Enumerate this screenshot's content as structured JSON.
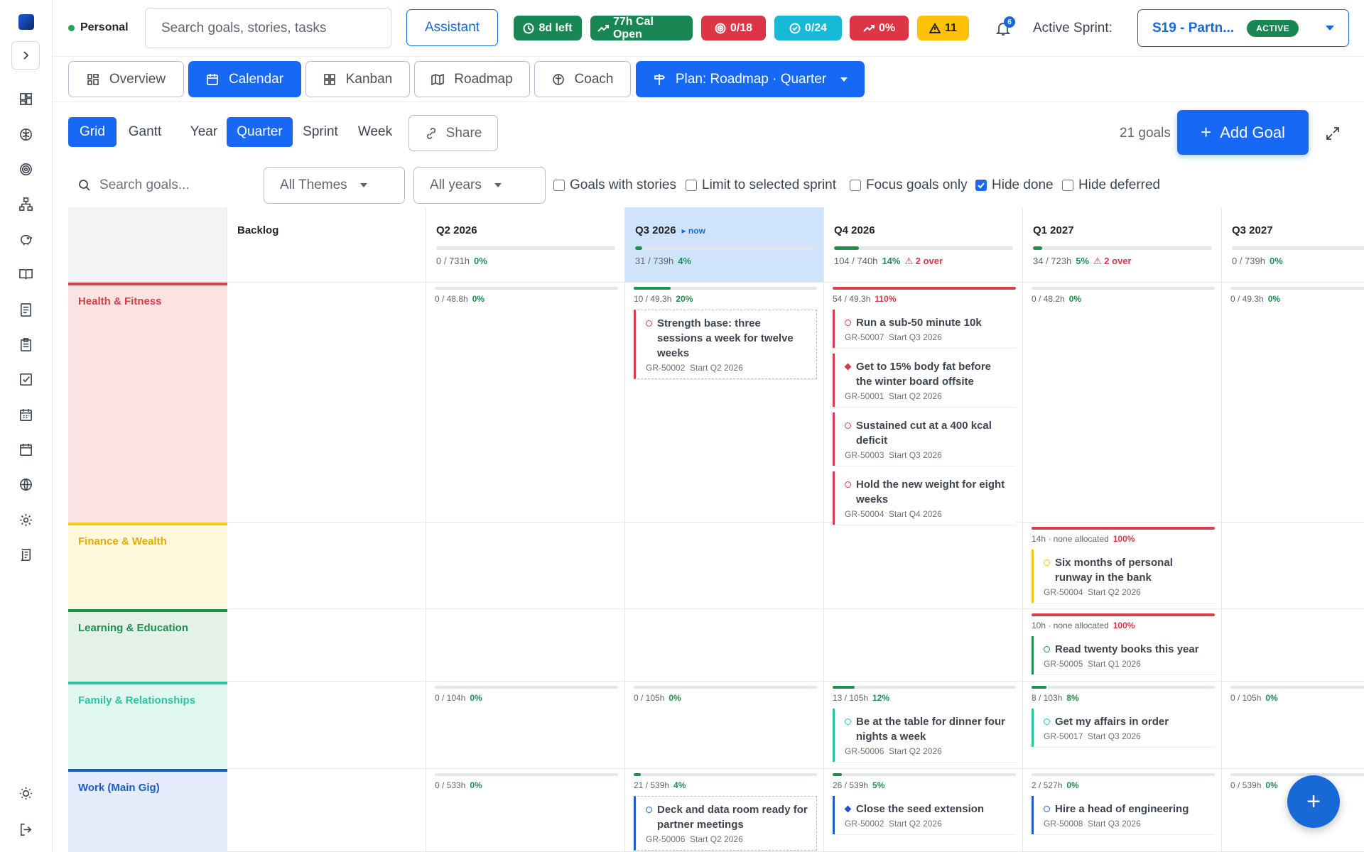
{
  "workspace": "Personal",
  "search": {
    "placeholder": "Search goals, stories, tasks"
  },
  "assistant_label": "Assistant",
  "badges": [
    {
      "label": "8d left",
      "color": "#198754",
      "icon": "clock-icon"
    },
    {
      "label": "77h Cal Open",
      "color": "#198754",
      "icon": "trend-up-icon"
    },
    {
      "label": "0/18",
      "color": "#dc3545",
      "icon": "target-icon"
    },
    {
      "label": "0/24",
      "color": "#17b8d8",
      "icon": "check-circle-icon"
    },
    {
      "label": "0%",
      "color": "#dc3545",
      "icon": "trend-up-icon"
    },
    {
      "label": "11",
      "color": "#ffc107",
      "icon": "warning-icon"
    }
  ],
  "notifications": {
    "count": "6"
  },
  "sprint": {
    "label": "Active Sprint:",
    "name": "S19 - Partn...",
    "status": "ACTIVE"
  },
  "tabs": [
    {
      "label": "Overview",
      "icon": "grid-icon"
    },
    {
      "label": "Calendar",
      "icon": "calendar-icon",
      "active": true
    },
    {
      "label": "Kanban",
      "icon": "grid-icon"
    },
    {
      "label": "Roadmap",
      "icon": "map-icon"
    },
    {
      "label": "Coach",
      "icon": "brain-icon"
    }
  ],
  "plan_label": "Plan: Roadmap · Quarter",
  "views": {
    "grid": "Grid",
    "gantt": "Gantt"
  },
  "ranges": {
    "year": "Year",
    "quarter": "Quarter",
    "sprint": "Sprint",
    "week": "Week"
  },
  "share_label": "Share",
  "goal_count": "21 goals",
  "add_goal_label": "Add Goal",
  "filters": {
    "search_placeholder": "Search goals...",
    "themes": "All Themes",
    "years": "All years",
    "checks": [
      {
        "label": "Goals with stories",
        "checked": false
      },
      {
        "label": "Limit to selected sprint",
        "checked": false
      },
      {
        "label": "Focus goals only",
        "checked": false
      },
      {
        "label": "Hide done",
        "checked": true
      },
      {
        "label": "Hide deferred",
        "checked": false
      }
    ]
  },
  "columns": [
    {
      "name": "Backlog"
    },
    {
      "name": "Q2 2026",
      "hours": "0 / 731h",
      "pct": "0%",
      "progress": 0
    },
    {
      "name": "Q3 2026",
      "now": "▸ now",
      "hours": "31 / 739h",
      "pct": "4%",
      "progress": 4
    },
    {
      "name": "Q4 2026",
      "hours": "104 / 740h",
      "pct": "14%",
      "over": "⚠ 2 over",
      "progress": 14
    },
    {
      "name": "Q1 2027",
      "hours": "34 / 723h",
      "pct": "5%",
      "over": "⚠ 2 over",
      "progress": 5
    },
    {
      "name": "Q3 2027",
      "hours": "0 / 739h",
      "pct": "0%",
      "progress": 0
    }
  ],
  "themes": [
    {
      "name": "Health & Fitness",
      "color": "#d43f4a",
      "bg": "#fbe3e4",
      "cells": [
        null,
        {
          "hours": "0 / 48.8h",
          "pct": "0%",
          "progress": 0,
          "cards": []
        },
        {
          "hours": "10 / 49.3h",
          "pct": "20%",
          "progress": 20,
          "barColor": "#1e8f4e",
          "cards": [
            {
              "title": "Strength base: three sessions a week for twelve weeks",
              "id": "GR-50002",
              "start": "Start Q2 2026",
              "dashed": true,
              "marker": "ring"
            }
          ]
        },
        {
          "hours": "54 / 49.3h",
          "pct": "110%",
          "progress": 100,
          "barColor": "#d43f4a",
          "pctOver": true,
          "cards": [
            {
              "title": "Run a sub-50 minute 10k",
              "id": "GR-50007",
              "start": "Start Q3 2026",
              "marker": "ring"
            },
            {
              "title": "Get to 15% body fat before the winter board offsite",
              "id": "GR-50001",
              "start": "Start Q2 2026",
              "marker": "diamond"
            },
            {
              "title": "Sustained cut at a 400 kcal deficit",
              "id": "GR-50003",
              "start": "Start Q3 2026",
              "marker": "ring"
            },
            {
              "title": "Hold the new weight for eight weeks",
              "id": "GR-50004",
              "start": "Start Q4 2026",
              "marker": "ring"
            }
          ]
        },
        {
          "hours": "0 / 48.2h",
          "pct": "0%",
          "progress": 0,
          "cards": []
        },
        {
          "hours": "0 / 49.3h",
          "pct": "0%",
          "progress": 0,
          "cards": []
        }
      ]
    },
    {
      "name": "Finance & Wealth",
      "color": "#f5c518",
      "bg": "#fff8dc",
      "cells": [
        null,
        null,
        null,
        null,
        {
          "hours": "14h · none allocated",
          "pct": "100%",
          "progress": 100,
          "barColor": "#d43f4a",
          "pctOver": true,
          "cards": [
            {
              "title": "Six months of personal runway in the bank",
              "id": "GR-50004",
              "start": "Start Q2 2026",
              "marker": "ring"
            }
          ]
        },
        null
      ]
    },
    {
      "name": "Learning & Education",
      "color": "#1e8f4e",
      "bg": "#e3f1e8",
      "cells": [
        null,
        null,
        null,
        null,
        {
          "hours": "10h · none allocated",
          "pct": "100%",
          "progress": 100,
          "barColor": "#d43f4a",
          "pctOver": true,
          "cards": [
            {
              "title": "Read twenty books this year",
              "id": "GR-50005",
              "start": "Start Q1 2026",
              "marker": "ring"
            }
          ]
        },
        null
      ]
    },
    {
      "name": "Family & Relationships",
      "color": "#2ec4a0",
      "bg": "#e0f7f0",
      "cells": [
        null,
        {
          "hours": "0 / 104h",
          "pct": "0%",
          "progress": 0,
          "cards": []
        },
        {
          "hours": "0 / 105h",
          "pct": "0%",
          "progress": 0,
          "cards": []
        },
        {
          "hours": "13 / 105h",
          "pct": "12%",
          "progress": 12,
          "barColor": "#1e8f4e",
          "cards": [
            {
              "title": "Be at the table for dinner four nights a week",
              "id": "GR-50006",
              "start": "Start Q2 2026",
              "marker": "ring"
            }
          ]
        },
        {
          "hours": "8 / 103h",
          "pct": "8%",
          "progress": 8,
          "barColor": "#1e8f4e",
          "cards": [
            {
              "title": "Get my affairs in order",
              "id": "GR-50017",
              "start": "Start Q3 2026",
              "marker": "ring"
            }
          ]
        },
        {
          "hours": "0 / 105h",
          "pct": "0%",
          "progress": 0,
          "cards": []
        }
      ]
    },
    {
      "name": "Work (Main Gig)",
      "color": "#1e5bc6",
      "bg": "#e4ebfb",
      "cells": [
        null,
        {
          "hours": "0 / 533h",
          "pct": "0%",
          "progress": 0,
          "cards": []
        },
        {
          "hours": "21 / 539h",
          "pct": "4%",
          "progress": 4,
          "barColor": "#1e8f4e",
          "cards": [
            {
              "title": "Deck and data room ready for partner meetings",
              "id": "GR-50006",
              "start": "Start Q2 2026",
              "dashed": true,
              "marker": "ring"
            }
          ]
        },
        {
          "hours": "26 / 539h",
          "pct": "5%",
          "progress": 5,
          "barColor": "#1e8f4e",
          "cards": [
            {
              "title": "Close the seed extension",
              "id": "GR-50002",
              "start": "Start Q2 2026",
              "marker": "diamond"
            }
          ]
        },
        {
          "hours": "2 / 527h",
          "pct": "0%",
          "progress": 0,
          "cards": [
            {
              "title": "Hire a head of engineering",
              "id": "GR-50008",
              "start": "Start Q3 2026",
              "marker": "ring"
            }
          ]
        },
        {
          "hours": "0 / 539h",
          "pct": "0%",
          "progress": 0,
          "cards": []
        }
      ]
    }
  ]
}
